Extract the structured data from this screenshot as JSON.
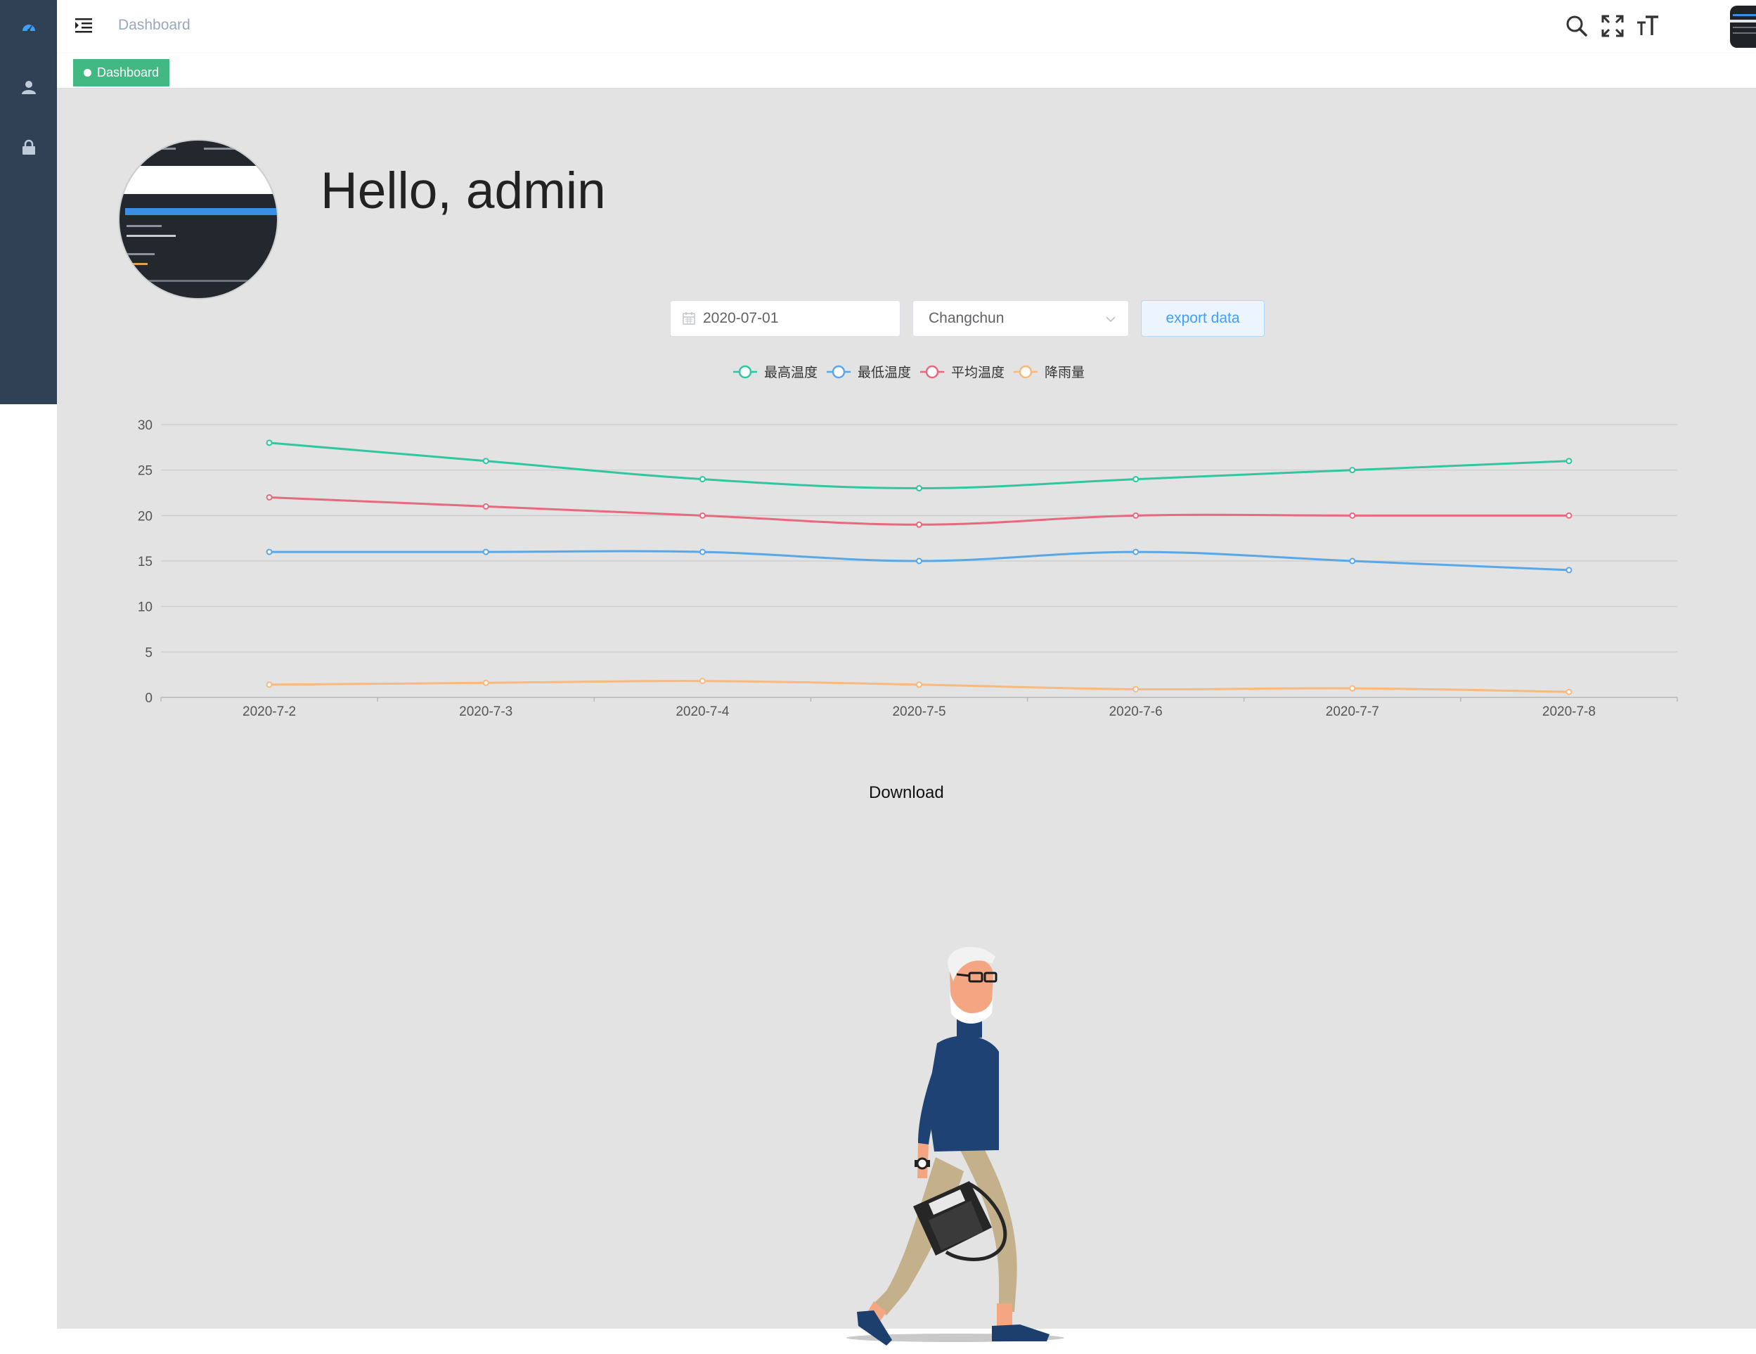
{
  "navbar": {
    "breadcrumb": "Dashboard"
  },
  "tags": {
    "active": "Dashboard"
  },
  "main": {
    "greeting": "Hello, admin",
    "date_value": "2020-07-01",
    "city_value": "Changchun",
    "export_label": "export data",
    "download_label": "Download"
  },
  "colors": {
    "sidebar": "#304156",
    "tag_active": "#42b983",
    "max_temp": "#2ec7a0",
    "min_temp": "#5aa7e8",
    "avg_temp": "#e8697e",
    "rainfall": "#f7b97d"
  },
  "icons": {
    "sidebar": [
      "dashboard-icon",
      "user-icon",
      "lock-icon"
    ],
    "navbar": [
      "search-icon",
      "fullscreen-icon",
      "text-size-icon"
    ]
  },
  "chart_data": {
    "type": "line",
    "categories": [
      "2020-7-2",
      "2020-7-3",
      "2020-7-4",
      "2020-7-5",
      "2020-7-6",
      "2020-7-7",
      "2020-7-8"
    ],
    "series": [
      {
        "name": "最高温度",
        "color": "#2ec7a0",
        "values": [
          28,
          26,
          24,
          23,
          24,
          25,
          26
        ]
      },
      {
        "name": "最低温度",
        "color": "#5aa7e8",
        "values": [
          16,
          16,
          16,
          15,
          16,
          15,
          14
        ]
      },
      {
        "name": "平均温度",
        "color": "#e8697e",
        "values": [
          22,
          21,
          20,
          19,
          20,
          20,
          20
        ]
      },
      {
        "name": "降雨量",
        "color": "#f7b97d",
        "values": [
          1.4,
          1.6,
          1.8,
          1.4,
          0.9,
          1.0,
          0.6
        ]
      }
    ],
    "ylim": [
      0,
      30
    ],
    "yticks": [
      0,
      5,
      10,
      15,
      20,
      25,
      30
    ],
    "legend": "top-center",
    "grid": true,
    "smooth": true
  }
}
